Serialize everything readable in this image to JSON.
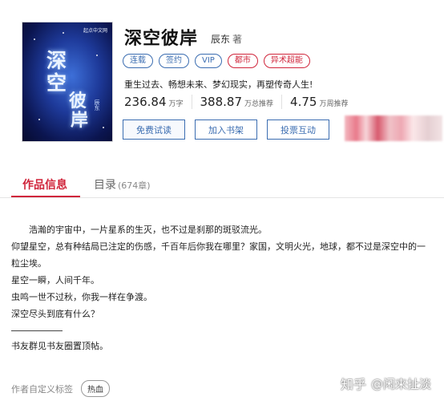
{
  "book": {
    "cover": {
      "publisher": "起点中文网",
      "title_chars": [
        "深",
        "空",
        "彼",
        "岸"
      ],
      "author": "辰东"
    },
    "title": "深空彼岸",
    "author": "辰东",
    "author_suffix": "著",
    "tags": [
      {
        "label": "连载",
        "color": "#3b6db1"
      },
      {
        "label": "签约",
        "color": "#3b6db1"
      },
      {
        "label": "VIP",
        "color": "#3b6db1"
      },
      {
        "label": "都市",
        "color": "#d0253b"
      },
      {
        "label": "异术超能",
        "color": "#d0253b"
      }
    ],
    "intro": "重生过去、畅想未来、梦幻现实，再塑传奇人生!",
    "stats": [
      {
        "value": "236.84",
        "unit": "万字"
      },
      {
        "value": "388.87",
        "unit": "万总推荐"
      },
      {
        "value": "4.75",
        "unit": "万周推荐"
      }
    ],
    "buttons": [
      "免费试读",
      "加入书架",
      "投票互动"
    ]
  },
  "tabs": {
    "info": "作品信息",
    "catalog": "目录",
    "catalog_count": "(674章)"
  },
  "description": {
    "lines": [
      "浩瀚的宇宙中，一片星系的生灭，也不过是刹那的斑驳流光。",
      "仰望星空，总有种结局已注定的伤感，千百年后你我在哪里？家国，文明火光，地球，都不过是深空中的一粒尘埃。",
      "星空一瞬，人间千年。",
      "虫鸣一世不过秋，你我一样在争渡。",
      "深空尽头到底有什么？"
    ],
    "note": "书友群见书友圈置顶帖。"
  },
  "footer": {
    "label": "作者自定义标签",
    "chip": "热血"
  },
  "watermark": {
    "site": "知乎",
    "user": "@闲来扯淡"
  },
  "colors": {
    "accent_red": "#d0253b",
    "accent_blue": "#3b6db1"
  }
}
